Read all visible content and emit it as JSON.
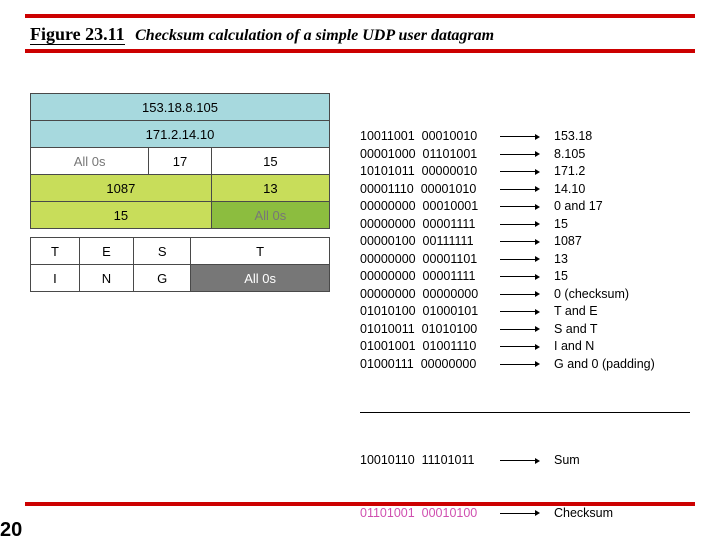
{
  "title": {
    "figure_label": "Figure 23.11",
    "caption": "Checksum calculation of a simple UDP user datagram"
  },
  "header_table": {
    "row_src_ip": "153.18.8.105",
    "row_dst_ip": "171.2.14.10",
    "row3": {
      "c1": "All 0s",
      "c2": "17",
      "c3": "15"
    },
    "row4": {
      "c1": "1087",
      "c2": "13"
    },
    "row5": {
      "c1": "15",
      "c2": "All 0s"
    }
  },
  "data_table": {
    "row1": {
      "c1": "T",
      "c2": "E",
      "c3": "S",
      "c4": "T"
    },
    "row2": {
      "c1": "I",
      "c2": "N",
      "c3": "G",
      "c4": "All 0s"
    }
  },
  "calc": [
    {
      "bin": "10011001  00010010",
      "meaning": "153.18"
    },
    {
      "bin": "00001000  01101001",
      "meaning": "8.105"
    },
    {
      "bin": "10101011  00000010",
      "meaning": "171.2"
    },
    {
      "bin": "00001110  00001010",
      "meaning": "14.10"
    },
    {
      "bin": "00000000  00010001",
      "meaning": "0 and 17"
    },
    {
      "bin": "00000000  00001111",
      "meaning": "15"
    },
    {
      "bin": "00000100  00111111",
      "meaning": "1087"
    },
    {
      "bin": "00000000  00001101",
      "meaning": "13"
    },
    {
      "bin": "00000000  00001111",
      "meaning": "15"
    },
    {
      "bin": "00000000  00000000",
      "meaning": "0 (checksum)"
    },
    {
      "bin": "01010100  01000101",
      "meaning": "T and E"
    },
    {
      "bin": "01010011  01010100",
      "meaning": "S and T"
    },
    {
      "bin": "01001001  01001110",
      "meaning": "I and N"
    },
    {
      "bin": "01000111  00000000",
      "meaning": "G and 0 (padding)"
    }
  ],
  "sum": {
    "bin": "10010110  11101011",
    "meaning": "Sum"
  },
  "checksum": {
    "bin": "01101001  00010100",
    "meaning": "Checksum"
  },
  "slide_number": "20"
}
